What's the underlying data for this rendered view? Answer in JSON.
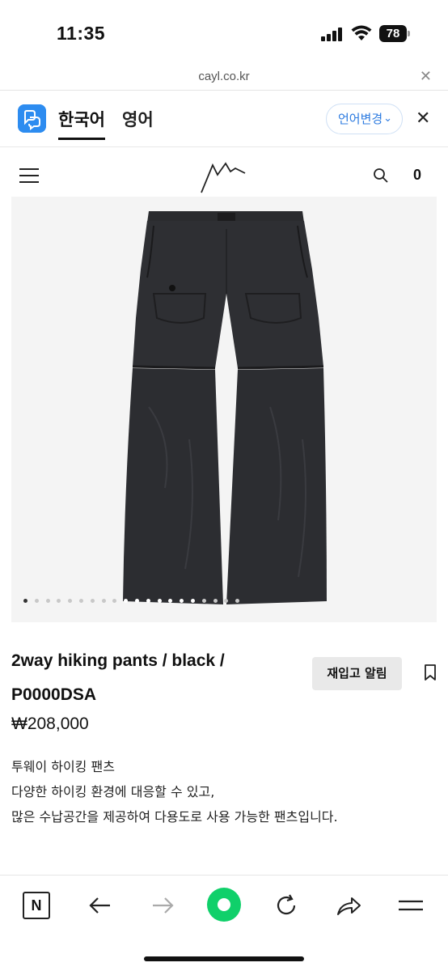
{
  "status_bar": {
    "time": "11:35",
    "battery": "78"
  },
  "browser": {
    "url": "cayl.co.kr",
    "close_icon": "close-icon"
  },
  "translate_bar": {
    "lang_korean": "한국어",
    "lang_english": "영어",
    "change_language": "언어변경",
    "accent_color": "#2d8cf0"
  },
  "site_header": {
    "cart_count": "0"
  },
  "product": {
    "name": "2way hiking pants / black / P0000DSA",
    "restock_label": "재입고 알림",
    "price": "₩208,000",
    "description_lines": [
      "투웨이 하이킹 팬츠",
      "다양한 하이킹 환경에 대응할 수 있고,",
      "많은 수납공간을 제공하여 다용도로 사용 가능한 팬츠입니다."
    ],
    "image_alt": "black 2-way hiking pants",
    "carousel": {
      "total_slides": 20,
      "active_slide": 1
    }
  },
  "toolbar": {
    "items": [
      "naver-n-icon",
      "back-arrow-icon",
      "forward-arrow-icon",
      "green-home-icon",
      "reload-icon",
      "share-icon",
      "menu-icon"
    ]
  }
}
